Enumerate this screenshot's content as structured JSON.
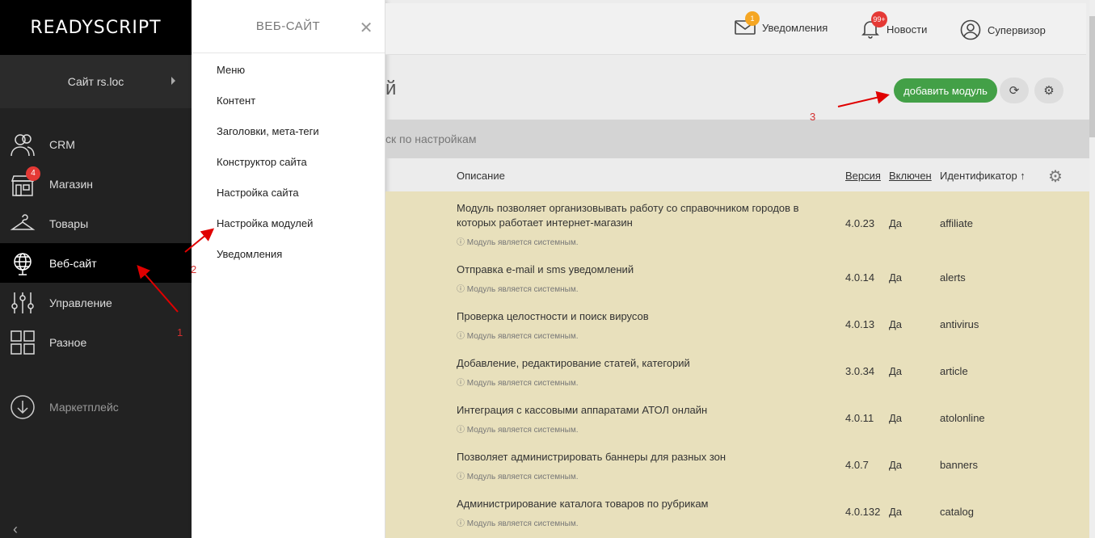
{
  "brand": "READYSCRIPT",
  "site_selector": "Сайт rs.loc",
  "nav": [
    {
      "label": "CRM",
      "icon": "users-icon"
    },
    {
      "label": "Магазин",
      "icon": "shop-icon",
      "badge": "4"
    },
    {
      "label": "Товары",
      "icon": "hanger-icon"
    },
    {
      "label": "Веб-сайт",
      "icon": "globe-icon",
      "active": true
    },
    {
      "label": "Управление",
      "icon": "sliders-icon"
    },
    {
      "label": "Разное",
      "icon": "grid-icon"
    }
  ],
  "marketplace": "Маркетплейс",
  "flyout": {
    "title": "ВЕБ-САЙТ",
    "items": [
      "Меню",
      "Контент",
      "Заголовки, мета-теги",
      "Конструктор сайта",
      "Настройка сайта",
      "Настройка модулей",
      "Уведомления"
    ]
  },
  "topbar": {
    "notifications": {
      "label": "Уведомления",
      "badge": "1"
    },
    "news": {
      "label": "Новости",
      "badge": "99+"
    },
    "user": {
      "label": "Супервизор"
    }
  },
  "page": {
    "title_fragment": "й",
    "add_button": "добавить модуль",
    "search_placeholder": "ск по настройкам"
  },
  "table": {
    "headers": {
      "description": "Описание",
      "version": "Версия",
      "enabled": "Включен",
      "identifier": "Идентификатор ↑"
    },
    "system_note": "ⓘ Модуль является системным.",
    "rows": [
      {
        "desc": "Модуль позволяет организовывать работу со справочником городов в которых работает интернет-магазин",
        "version": "4.0.23",
        "enabled": "Да",
        "id": "affiliate"
      },
      {
        "desc": "Отправка e-mail и sms уведомлений",
        "version": "4.0.14",
        "enabled": "Да",
        "id": "alerts"
      },
      {
        "desc": "Проверка целостности и поиск вирусов",
        "version": "4.0.13",
        "enabled": "Да",
        "id": "antivirus"
      },
      {
        "desc": "Добавление, редактирование статей, категорий",
        "version": "3.0.34",
        "enabled": "Да",
        "id": "article"
      },
      {
        "desc": "Интеграция с кассовыми аппаратами АТОЛ онлайн",
        "version": "4.0.11",
        "enabled": "Да",
        "id": "atolonline"
      },
      {
        "desc": "Позволяет администрировать баннеры для разных зон",
        "version": "4.0.7",
        "enabled": "Да",
        "id": "banners"
      },
      {
        "desc": "Администрирование каталога товаров по рубрикам",
        "version": "4.0.132",
        "enabled": "Да",
        "id": "catalog"
      }
    ]
  },
  "annotations": [
    "1",
    "2",
    "3"
  ],
  "colors": {
    "accent_green": "#43a047",
    "badge_red": "#e53935",
    "badge_yellow": "#f5a623",
    "row_bg": "#e8e0bc",
    "arrow_red": "#e00000"
  }
}
